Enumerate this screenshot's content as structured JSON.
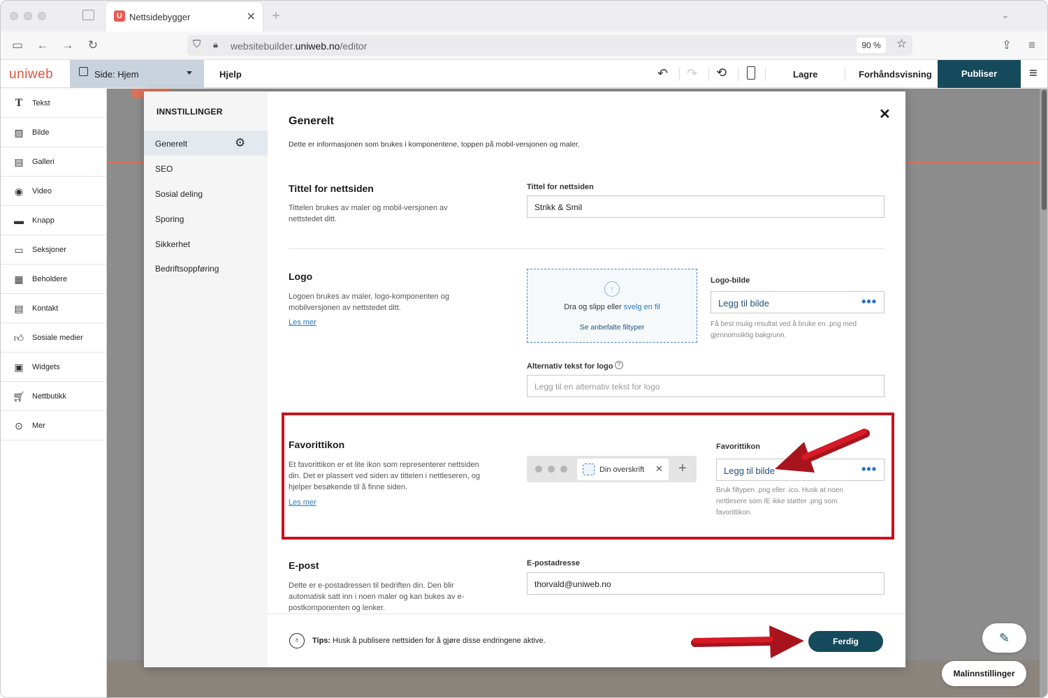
{
  "browser": {
    "tab_title": "Nettsidebygger",
    "tab_favicon": "U",
    "url_prefix": "websitebuilder.",
    "url_domain": "uniweb.no",
    "url_path": "/editor",
    "zoom": "90 %"
  },
  "toolbar": {
    "logo": "uniweb",
    "page_selector": "Side: Hjem",
    "help": "Hjelp",
    "save": "Lagre",
    "preview": "Forhåndsvisning",
    "publish": "Publiser"
  },
  "sidebar": {
    "items": [
      {
        "label": "Tekst",
        "icon": "text-icon"
      },
      {
        "label": "Bilde",
        "icon": "image-icon"
      },
      {
        "label": "Galleri",
        "icon": "gallery-icon"
      },
      {
        "label": "Video",
        "icon": "video-icon"
      },
      {
        "label": "Knapp",
        "icon": "button-icon"
      },
      {
        "label": "Seksjoner",
        "icon": "sections-icon"
      },
      {
        "label": "Beholdere",
        "icon": "containers-icon"
      },
      {
        "label": "Kontakt",
        "icon": "contact-icon"
      },
      {
        "label": "Sosiale medier",
        "icon": "thumbs-up-icon"
      },
      {
        "label": "Widgets",
        "icon": "widgets-icon"
      },
      {
        "label": "Nettbutikk",
        "icon": "cart-icon"
      },
      {
        "label": "Mer",
        "icon": "more-icon"
      }
    ]
  },
  "modal": {
    "heading": "INNSTILLINGER",
    "nav": [
      "Generelt",
      "SEO",
      "Sosial deling",
      "Sporing",
      "Sikkerhet",
      "Bedriftsoppføring"
    ],
    "title": "Generelt",
    "intro": "Dette er informasjonen som brukes i komponentene, toppen på mobil-versjonen og maler.",
    "site_title": {
      "heading": "Tittel for nettsiden",
      "desc": "Tittelen brukes av maler og mobil-versjonen av nettstedet ditt.",
      "field_label": "Tittel for nettsiden",
      "value": "Strikk & Smil"
    },
    "logo": {
      "heading": "Logo",
      "desc": "Logoen brukes av maler, logo-komponenten og mobilversjonen av nettstedet ditt.",
      "read_more": "Les mer",
      "drop_text": "Dra og slipp eller ",
      "drop_link": "svelg en fil",
      "file_types": "Se anbefalte filtyper",
      "field_label": "Logo-bilde",
      "button": "Legg til bilde",
      "hint": "Få best mulig resultat ved å bruke en .png med gjennomsiktig bakgrunn.",
      "alt_label": "Alternativ tekst for logo",
      "alt_placeholder": "Legg til en alternativ tekst for logo"
    },
    "favicon": {
      "heading": "Favorittikon",
      "desc": "Et favorittikon er et lite ikon som representerer nettsiden din. Det er plassert ved siden av tittelen i nettleseren, og hjelper besøkende til å finne siden.",
      "read_more": "Les mer",
      "mock_tab": "Din overskrift",
      "field_label": "Favorittikon",
      "button": "Legg til bilde",
      "hint": "Bruk filtypen .png eller .ico. Husk at noen nettlesere som IE ikke støtter .png som favorittikon."
    },
    "email": {
      "heading": "E-post",
      "desc": "Dette er e-postadressen til bedriften din. Den blir automatisk satt inn i noen maler og kan bukes av e-postkomponenten og lenker.",
      "field_label": "E-postadresse",
      "value": "thorvald@uniweb.no"
    },
    "tips_label": "Tips:",
    "tips_text": " Husk å publisere nettsiden for å gjøre disse endringene aktive.",
    "done": "Ferdig"
  },
  "canvas": {
    "template_settings": "Malinnstillinger"
  },
  "colors": {
    "accent": "#154a5c",
    "brand": "#e0533d",
    "highlight": "#c6131e"
  }
}
